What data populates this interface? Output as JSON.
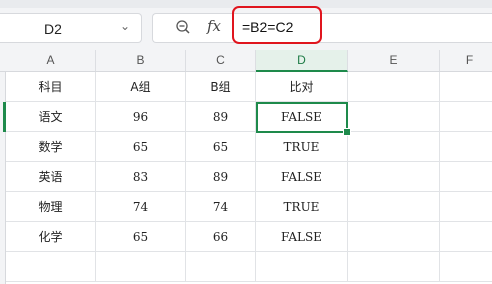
{
  "name_box": {
    "value": "D2"
  },
  "formula_bar": {
    "formula": "=B2=C2",
    "fx_label": "fx"
  },
  "columns": [
    "A",
    "B",
    "C",
    "D",
    "E",
    "F"
  ],
  "rows": [
    [
      "科目",
      "A组",
      "B组",
      "比对"
    ],
    [
      "语文",
      "96",
      "89",
      "FALSE"
    ],
    [
      "数学",
      "65",
      "65",
      "TRUE"
    ],
    [
      "英语",
      "83",
      "89",
      "FALSE"
    ],
    [
      "物理",
      "74",
      "74",
      "TRUE"
    ],
    [
      "化学",
      "65",
      "66",
      "FALSE"
    ]
  ],
  "colors": {
    "accent": "#1e8a4b",
    "highlight": "#e0151e"
  }
}
